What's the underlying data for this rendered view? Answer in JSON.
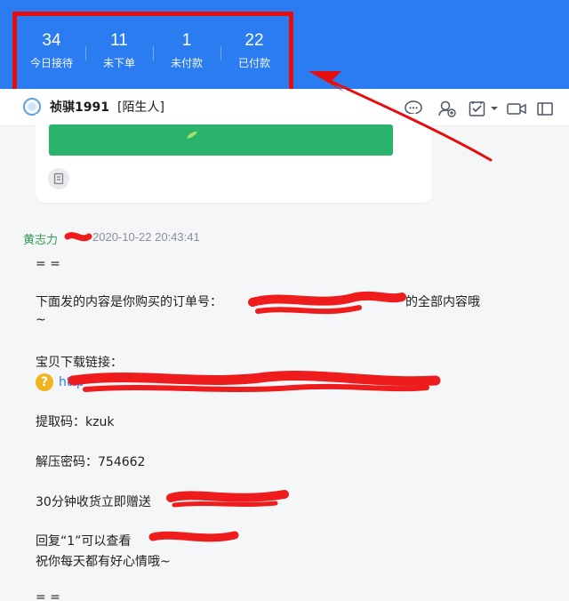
{
  "stats": [
    {
      "value": "34",
      "label": "今日接待"
    },
    {
      "value": "11",
      "label": "未下单"
    },
    {
      "value": "1",
      "label": "未付款"
    },
    {
      "value": "22",
      "label": "已付款"
    }
  ],
  "contact": {
    "name": "祯骐1991",
    "tag": "[陌生人]"
  },
  "message": {
    "sender": "黄志力",
    "time": "2020-10-22 20:43:41",
    "lines": {
      "separator": "= =",
      "intro_prefix": "下面发的内容是你购买的订单号：",
      "intro_suffix": "的全部内容哦",
      "tilde": "~",
      "download_label": "宝贝下载链接：",
      "link_prefix": "http",
      "code": "提取码：kzuk",
      "unzip": "解压密码：754662",
      "gift": "30分钟收货立即赠送",
      "reply": "回复“1”可以查看",
      "wish": "祝你每天都有好心情哦~",
      "separator2": "= ="
    }
  },
  "colors": {
    "banner": "#2b7cf0",
    "annotation": "#e50f0f",
    "sender": "#2e9a4e",
    "link": "#2b7cf0"
  },
  "icons": [
    "chat-bubble-icon",
    "add-contact-icon",
    "checklist-icon",
    "chevron-down-icon",
    "video-icon",
    "window-icon",
    "help-icon"
  ]
}
